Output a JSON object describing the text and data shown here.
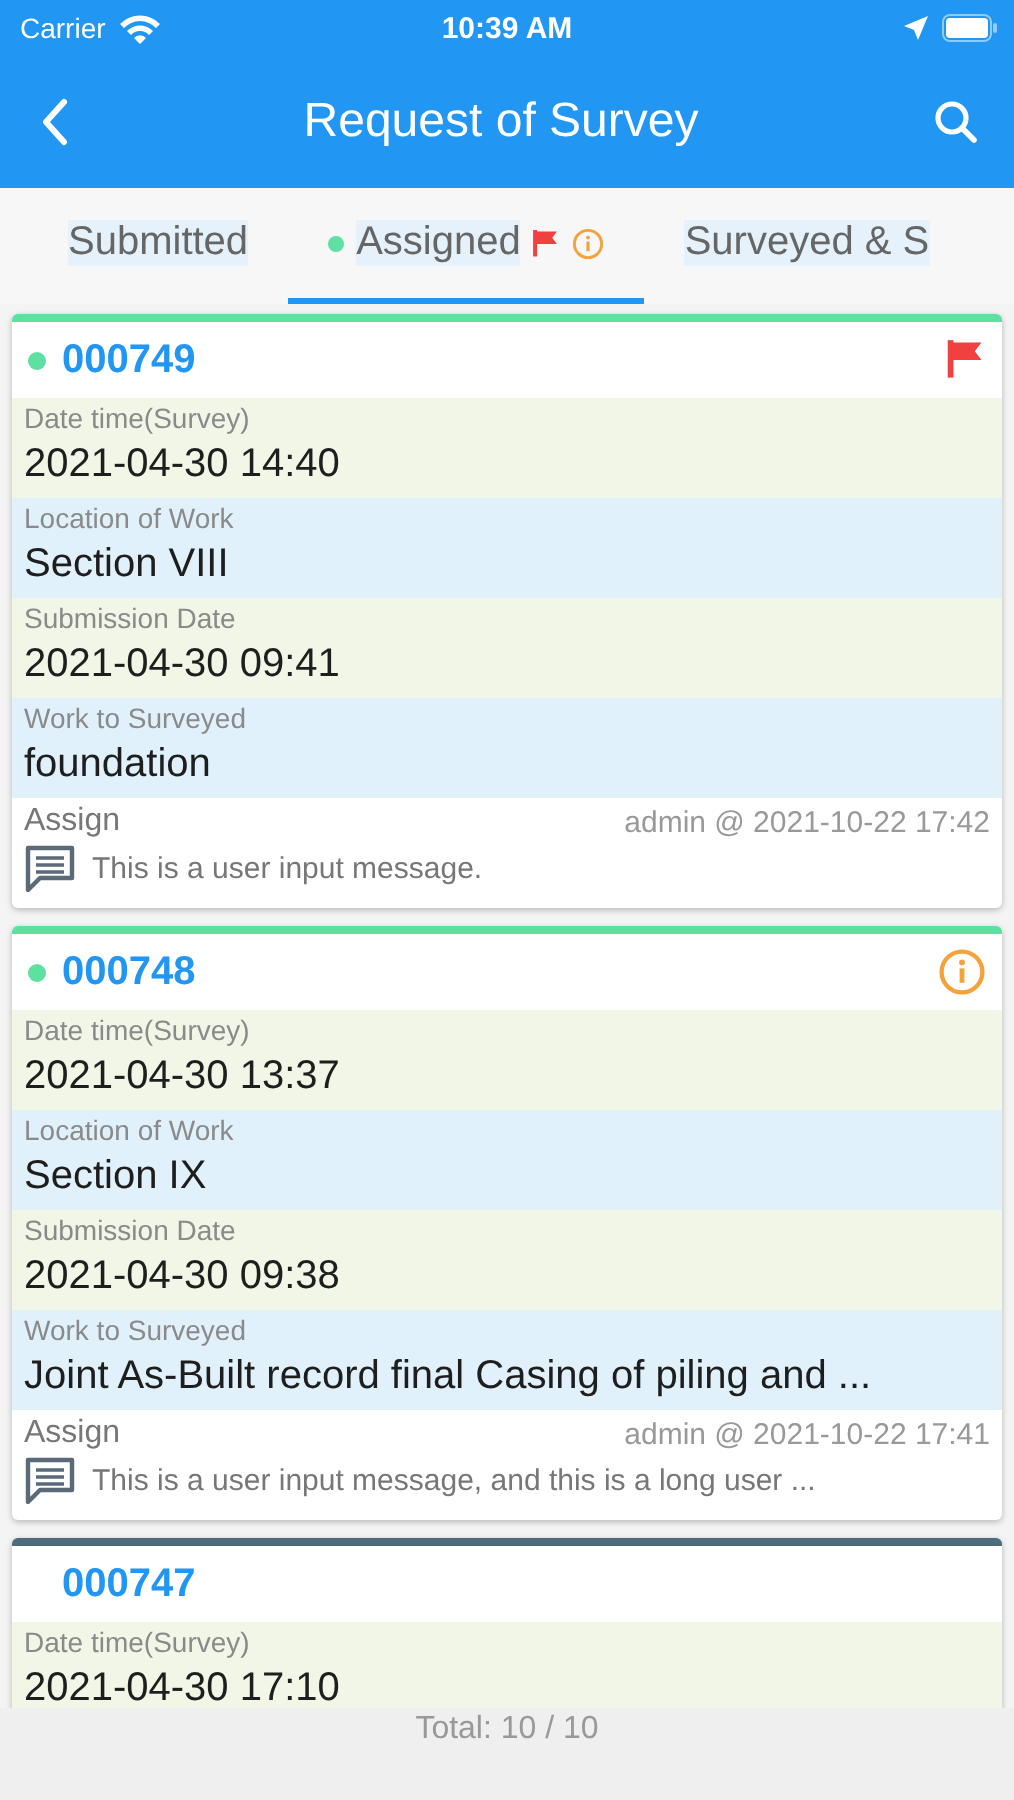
{
  "status_bar": {
    "carrier": "Carrier",
    "time": "10:39 AM"
  },
  "nav": {
    "title": "Request of Survey"
  },
  "tabs": [
    {
      "label": "Submitted",
      "selected": false,
      "dot": false,
      "flag": false,
      "info": false
    },
    {
      "label": "Assigned",
      "selected": true,
      "dot": true,
      "flag": true,
      "info": true
    },
    {
      "label": "Surveyed & S",
      "selected": false,
      "dot": false,
      "flag": false,
      "info": false
    }
  ],
  "cards": [
    {
      "id": "000749",
      "color": "#5ee0a0",
      "dot": true,
      "flag": true,
      "info": false,
      "fields": [
        {
          "label": "Date time(Survey)",
          "value": "2021-04-30 14:40"
        },
        {
          "label": "Location of Work",
          "value": "Section VIII"
        },
        {
          "label": "Submission Date",
          "value": "2021-04-30 09:41"
        },
        {
          "label": "Work to Surveyed",
          "value": "foundation"
        }
      ],
      "action": "Assign",
      "meta": "admin @ 2021-10-22 17:42",
      "message": "This is a user input message."
    },
    {
      "id": "000748",
      "color": "#5ee0a0",
      "dot": true,
      "flag": false,
      "info": true,
      "fields": [
        {
          "label": "Date time(Survey)",
          "value": "2021-04-30 13:37"
        },
        {
          "label": "Location of Work",
          "value": "Section IX"
        },
        {
          "label": "Submission Date",
          "value": "2021-04-30 09:38"
        },
        {
          "label": "Work to Surveyed",
          "value": "Joint As-Built record final Casing of piling and ..."
        }
      ],
      "action": "Assign",
      "meta": "admin @ 2021-10-22 17:41",
      "message": "This is a user input message, and this is a long user ..."
    },
    {
      "id": "000747",
      "color": "#4d6b7a",
      "dot": false,
      "flag": false,
      "info": false,
      "fields": [
        {
          "label": "Date time(Survey)",
          "value": "2021-04-30 17:10"
        }
      ]
    }
  ],
  "footer": {
    "total": "Total: 10 / 10"
  }
}
